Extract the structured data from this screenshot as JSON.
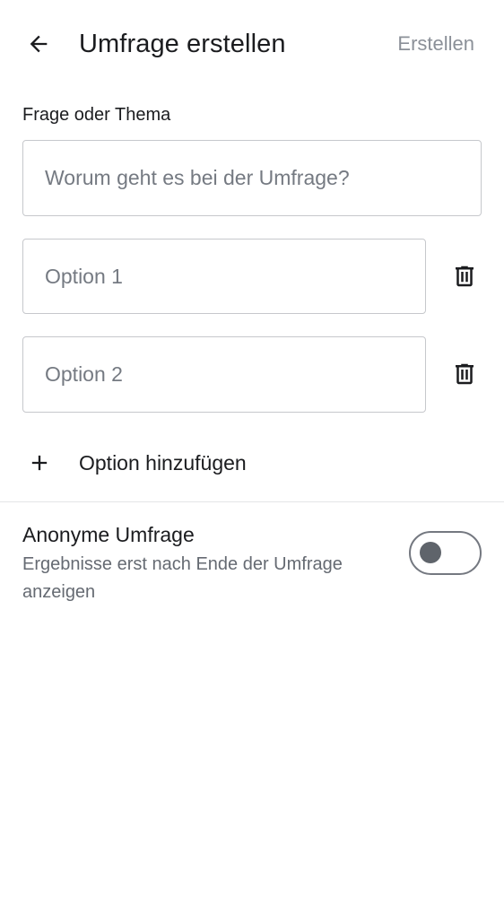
{
  "header": {
    "title": "Umfrage erstellen",
    "create_label": "Erstellen",
    "back_icon": "arrow-back-icon"
  },
  "question": {
    "label": "Frage oder Thema",
    "placeholder": "Worum geht es bei der Umfrage?",
    "value": ""
  },
  "options": [
    {
      "placeholder": "Option 1",
      "value": "",
      "delete_icon": "trash-icon"
    },
    {
      "placeholder": "Option 2",
      "value": "",
      "delete_icon": "trash-icon"
    }
  ],
  "add_option": {
    "label": "Option hinzufügen",
    "icon": "plus-icon"
  },
  "anonymous": {
    "title": "Anonyme Umfrage",
    "subtitle": "Ergebnisse erst nach Ende der Umfrage anzeigen",
    "enabled": false
  },
  "colors": {
    "text_primary": "#1b1c1f",
    "text_secondary": "#656a72",
    "disabled_action": "#8b9098",
    "field_border": "#c6c8cc",
    "toggle_off": "#5f646b"
  }
}
